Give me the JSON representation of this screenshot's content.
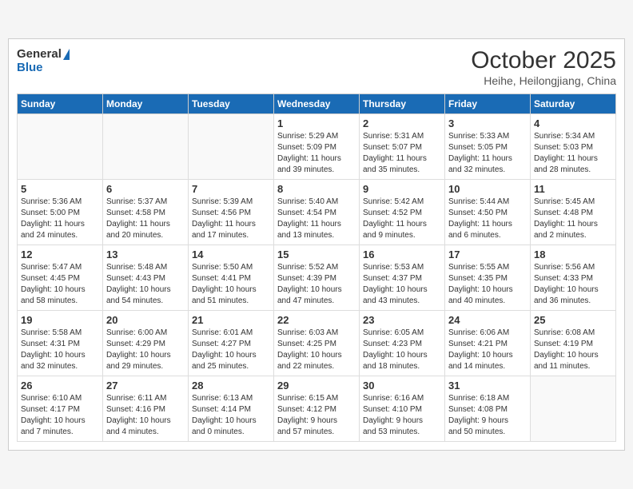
{
  "header": {
    "logo_general": "General",
    "logo_blue": "Blue",
    "month_title": "October 2025",
    "location": "Heihe, Heilongjiang, China"
  },
  "weekdays": [
    "Sunday",
    "Monday",
    "Tuesday",
    "Wednesday",
    "Thursday",
    "Friday",
    "Saturday"
  ],
  "weeks": [
    [
      {
        "day": "",
        "info": ""
      },
      {
        "day": "",
        "info": ""
      },
      {
        "day": "",
        "info": ""
      },
      {
        "day": "1",
        "info": "Sunrise: 5:29 AM\nSunset: 5:09 PM\nDaylight: 11 hours\nand 39 minutes."
      },
      {
        "day": "2",
        "info": "Sunrise: 5:31 AM\nSunset: 5:07 PM\nDaylight: 11 hours\nand 35 minutes."
      },
      {
        "day": "3",
        "info": "Sunrise: 5:33 AM\nSunset: 5:05 PM\nDaylight: 11 hours\nand 32 minutes."
      },
      {
        "day": "4",
        "info": "Sunrise: 5:34 AM\nSunset: 5:03 PM\nDaylight: 11 hours\nand 28 minutes."
      }
    ],
    [
      {
        "day": "5",
        "info": "Sunrise: 5:36 AM\nSunset: 5:00 PM\nDaylight: 11 hours\nand 24 minutes."
      },
      {
        "day": "6",
        "info": "Sunrise: 5:37 AM\nSunset: 4:58 PM\nDaylight: 11 hours\nand 20 minutes."
      },
      {
        "day": "7",
        "info": "Sunrise: 5:39 AM\nSunset: 4:56 PM\nDaylight: 11 hours\nand 17 minutes."
      },
      {
        "day": "8",
        "info": "Sunrise: 5:40 AM\nSunset: 4:54 PM\nDaylight: 11 hours\nand 13 minutes."
      },
      {
        "day": "9",
        "info": "Sunrise: 5:42 AM\nSunset: 4:52 PM\nDaylight: 11 hours\nand 9 minutes."
      },
      {
        "day": "10",
        "info": "Sunrise: 5:44 AM\nSunset: 4:50 PM\nDaylight: 11 hours\nand 6 minutes."
      },
      {
        "day": "11",
        "info": "Sunrise: 5:45 AM\nSunset: 4:48 PM\nDaylight: 11 hours\nand 2 minutes."
      }
    ],
    [
      {
        "day": "12",
        "info": "Sunrise: 5:47 AM\nSunset: 4:45 PM\nDaylight: 10 hours\nand 58 minutes."
      },
      {
        "day": "13",
        "info": "Sunrise: 5:48 AM\nSunset: 4:43 PM\nDaylight: 10 hours\nand 54 minutes."
      },
      {
        "day": "14",
        "info": "Sunrise: 5:50 AM\nSunset: 4:41 PM\nDaylight: 10 hours\nand 51 minutes."
      },
      {
        "day": "15",
        "info": "Sunrise: 5:52 AM\nSunset: 4:39 PM\nDaylight: 10 hours\nand 47 minutes."
      },
      {
        "day": "16",
        "info": "Sunrise: 5:53 AM\nSunset: 4:37 PM\nDaylight: 10 hours\nand 43 minutes."
      },
      {
        "day": "17",
        "info": "Sunrise: 5:55 AM\nSunset: 4:35 PM\nDaylight: 10 hours\nand 40 minutes."
      },
      {
        "day": "18",
        "info": "Sunrise: 5:56 AM\nSunset: 4:33 PM\nDaylight: 10 hours\nand 36 minutes."
      }
    ],
    [
      {
        "day": "19",
        "info": "Sunrise: 5:58 AM\nSunset: 4:31 PM\nDaylight: 10 hours\nand 32 minutes."
      },
      {
        "day": "20",
        "info": "Sunrise: 6:00 AM\nSunset: 4:29 PM\nDaylight: 10 hours\nand 29 minutes."
      },
      {
        "day": "21",
        "info": "Sunrise: 6:01 AM\nSunset: 4:27 PM\nDaylight: 10 hours\nand 25 minutes."
      },
      {
        "day": "22",
        "info": "Sunrise: 6:03 AM\nSunset: 4:25 PM\nDaylight: 10 hours\nand 22 minutes."
      },
      {
        "day": "23",
        "info": "Sunrise: 6:05 AM\nSunset: 4:23 PM\nDaylight: 10 hours\nand 18 minutes."
      },
      {
        "day": "24",
        "info": "Sunrise: 6:06 AM\nSunset: 4:21 PM\nDaylight: 10 hours\nand 14 minutes."
      },
      {
        "day": "25",
        "info": "Sunrise: 6:08 AM\nSunset: 4:19 PM\nDaylight: 10 hours\nand 11 minutes."
      }
    ],
    [
      {
        "day": "26",
        "info": "Sunrise: 6:10 AM\nSunset: 4:17 PM\nDaylight: 10 hours\nand 7 minutes."
      },
      {
        "day": "27",
        "info": "Sunrise: 6:11 AM\nSunset: 4:16 PM\nDaylight: 10 hours\nand 4 minutes."
      },
      {
        "day": "28",
        "info": "Sunrise: 6:13 AM\nSunset: 4:14 PM\nDaylight: 10 hours\nand 0 minutes."
      },
      {
        "day": "29",
        "info": "Sunrise: 6:15 AM\nSunset: 4:12 PM\nDaylight: 9 hours\nand 57 minutes."
      },
      {
        "day": "30",
        "info": "Sunrise: 6:16 AM\nSunset: 4:10 PM\nDaylight: 9 hours\nand 53 minutes."
      },
      {
        "day": "31",
        "info": "Sunrise: 6:18 AM\nSunset: 4:08 PM\nDaylight: 9 hours\nand 50 minutes."
      },
      {
        "day": "",
        "info": ""
      }
    ]
  ]
}
